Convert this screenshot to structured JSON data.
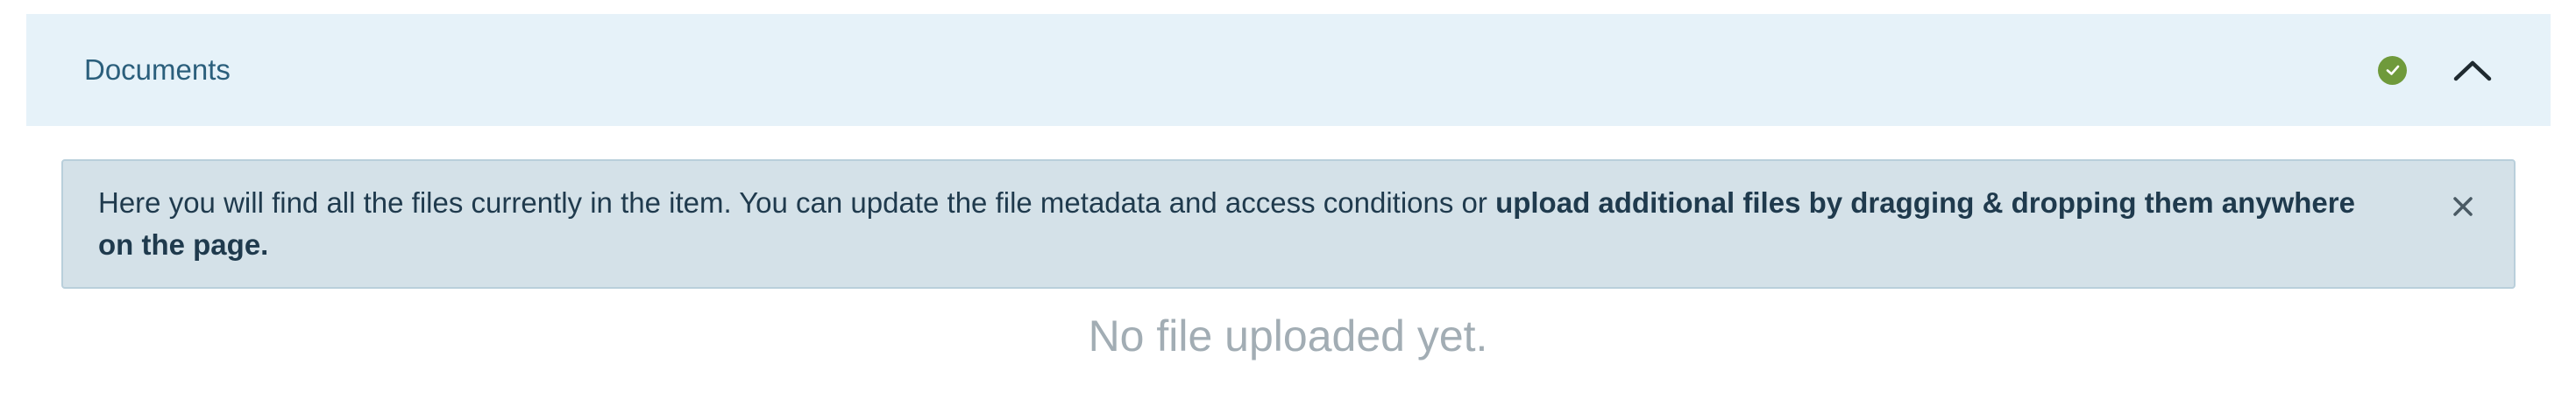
{
  "section": {
    "title": "Documents",
    "status_icon": "check-circle-icon",
    "status_color": "#6f9a3b",
    "collapse_icon": "chevron-up-icon"
  },
  "alert": {
    "text_regular": "Here you will find all the files currently in the item. You can update the file metadata and access conditions or ",
    "text_bold": "upload additional files by dragging & dropping them anywhere on the page.",
    "close_icon": "close-icon"
  },
  "empty_state": {
    "message": "No file uploaded yet."
  },
  "colors": {
    "header_bg": "#e6f2f9",
    "alert_bg": "#d4e1e8",
    "title_text": "#2b5f7c"
  }
}
